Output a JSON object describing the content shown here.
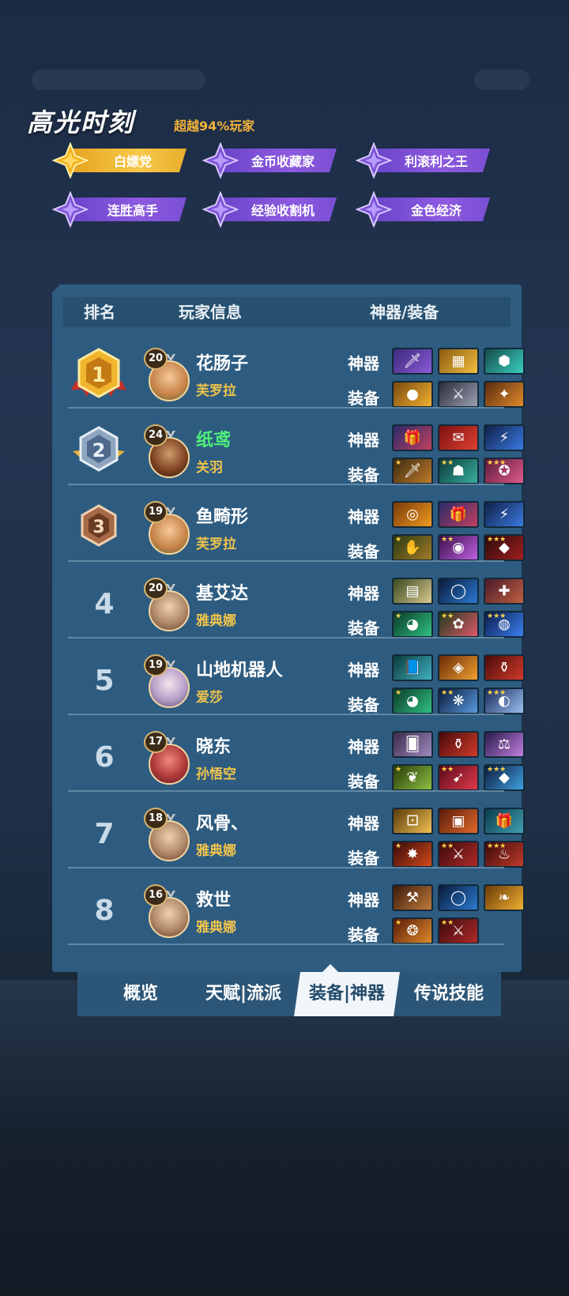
{
  "highlight": {
    "title": "高光时刻",
    "subtitle": "超越94%玩家",
    "badges": [
      {
        "label": "白嫖党",
        "style": "gold"
      },
      {
        "label": "金币收藏家",
        "style": "purple"
      },
      {
        "label": "利滚利之王",
        "style": "purple"
      },
      {
        "label": "连胜高手",
        "style": "purple"
      },
      {
        "label": "经验收割机",
        "style": "purple"
      },
      {
        "label": "金色经济",
        "style": "purple"
      }
    ]
  },
  "table": {
    "headers": {
      "rank": "排名",
      "player": "玩家信息",
      "gear": "神器/装备"
    },
    "artifact_label": "神器",
    "equip_label": "装备",
    "rows": [
      {
        "rank": "1",
        "level": "20",
        "name": "花肠子",
        "hero": "芙罗拉",
        "name_color": "#ffffff"
      },
      {
        "rank": "2",
        "level": "24",
        "name": "纸鸢",
        "hero": "关羽",
        "name_color": "#4ff07a"
      },
      {
        "rank": "3",
        "level": "19",
        "name": "鱼畸形",
        "hero": "芙罗拉",
        "name_color": "#ffffff"
      },
      {
        "rank": "4",
        "level": "20",
        "name": "基艾达",
        "hero": "雅典娜",
        "name_color": "#ffffff"
      },
      {
        "rank": "5",
        "level": "19",
        "name": "山地机器人",
        "hero": "爱莎",
        "name_color": "#ffffff"
      },
      {
        "rank": "6",
        "level": "17",
        "name": "晓东",
        "hero": "孙悟空",
        "name_color": "#ffffff"
      },
      {
        "rank": "7",
        "level": "18",
        "name": "风骨、",
        "hero": "雅典娜",
        "name_color": "#ffffff"
      },
      {
        "rank": "8",
        "level": "16",
        "name": "救世",
        "hero": "雅典娜",
        "name_color": "#ffffff"
      }
    ]
  },
  "tabs": [
    {
      "label": "概览",
      "active": false
    },
    {
      "label": "天赋|流派",
      "active": false
    },
    {
      "label": "装备|神器",
      "active": true
    },
    {
      "label": "传说技能",
      "active": false
    }
  ]
}
